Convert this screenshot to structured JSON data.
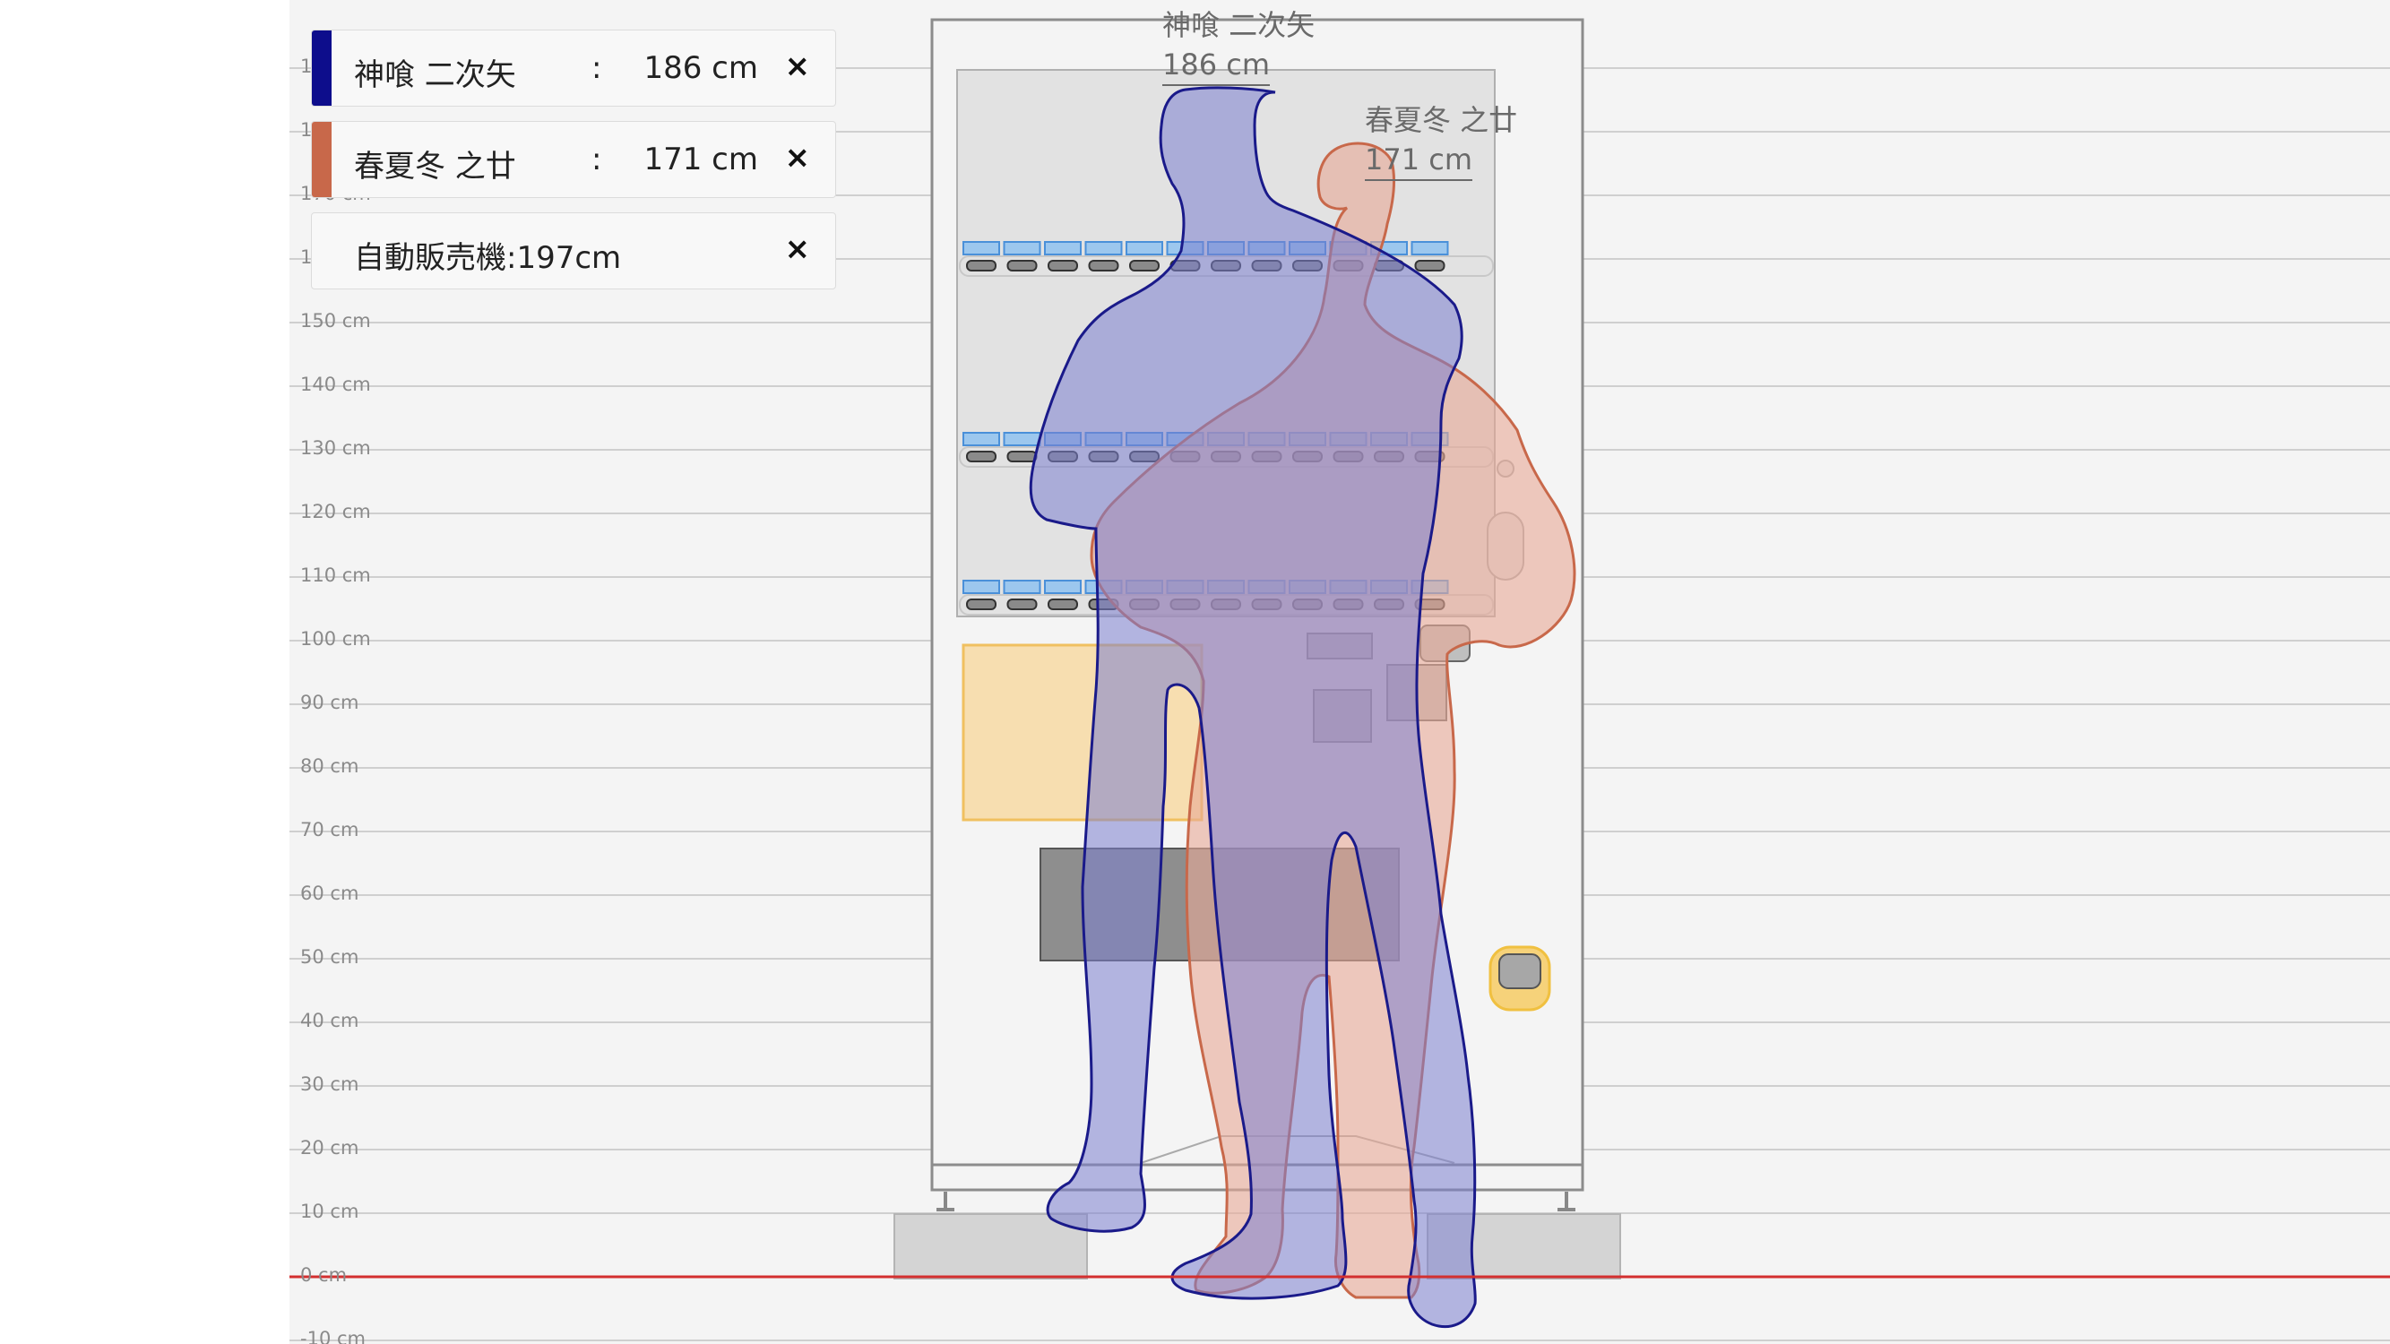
{
  "scale": {
    "ticks": [
      "190 cm",
      "180 cm",
      "170 cm",
      "160 cm",
      "150 cm",
      "140 cm",
      "130 cm",
      "120 cm",
      "110 cm",
      "100 cm",
      "90 cm",
      "80 cm",
      "70 cm",
      "60 cm",
      "50 cm",
      "40 cm",
      "30 cm",
      "20 cm",
      "10 cm",
      "0 cm",
      "-10 cm"
    ],
    "ground_line_color": "#d32f2f"
  },
  "panels": [
    {
      "name": "神喰 二次矢",
      "sep": ":",
      "height": "186 cm",
      "color": "#0d0d8c",
      "close": "×"
    },
    {
      "name": "春夏冬 之廿",
      "sep": ":",
      "height": "171 cm",
      "color": "#c8684a",
      "close": "×"
    },
    {
      "name": "自動販売機:197cm",
      "color": "#f8f8f8",
      "close": "×"
    }
  ],
  "figures": [
    {
      "name": "神喰 二次矢",
      "height": "186 cm",
      "height_cm": 186,
      "fill": "#7b7fd0",
      "stroke": "#1a1a8a"
    },
    {
      "name": "春夏冬 之廿",
      "height": "171 cm",
      "height_cm": 171,
      "fill": "#e8a996",
      "stroke": "#c8684a"
    }
  ],
  "machine": {
    "height_cm": 197,
    "shelf_color": "#4a90d9",
    "accent": "#f5c242"
  }
}
